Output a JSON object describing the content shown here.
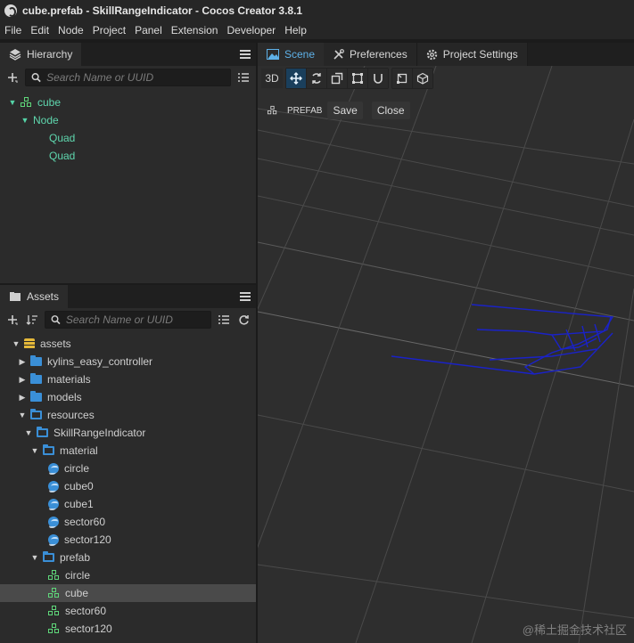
{
  "window": {
    "title": "cube.prefab - SkillRangeIndicator - Cocos Creator 3.8.1"
  },
  "menu": [
    "File",
    "Edit",
    "Node",
    "Project",
    "Panel",
    "Extension",
    "Developer",
    "Help"
  ],
  "hierarchy": {
    "tab_label": "Hierarchy",
    "search_placeholder": "Search Name or UUID",
    "nodes": [
      {
        "label": "cube",
        "depth": 0
      },
      {
        "label": "Node",
        "depth": 1
      },
      {
        "label": "Quad",
        "depth": 2
      },
      {
        "label": "Quad",
        "depth": 2
      }
    ]
  },
  "assets": {
    "tab_label": "Assets",
    "search_placeholder": "Search Name or UUID",
    "items": [
      {
        "label": "assets",
        "depth": 0,
        "icon": "assets-db-icon",
        "caret": "down"
      },
      {
        "label": "kylins_easy_controller",
        "depth": 1,
        "icon": "folder-icon",
        "caret": "right"
      },
      {
        "label": "materials",
        "depth": 1,
        "icon": "folder-icon",
        "caret": "right"
      },
      {
        "label": "models",
        "depth": 1,
        "icon": "folder-icon",
        "caret": "right"
      },
      {
        "label": "resources",
        "depth": 1,
        "icon": "folder-open-icon",
        "caret": "down"
      },
      {
        "label": "SkillRangeIndicator",
        "depth": 2,
        "icon": "folder-open-icon",
        "caret": "down"
      },
      {
        "label": "material",
        "depth": 3,
        "icon": "folder-open-icon",
        "caret": "down"
      },
      {
        "label": "circle",
        "depth": 4,
        "icon": "material-icon"
      },
      {
        "label": "cube0",
        "depth": 4,
        "icon": "material-icon"
      },
      {
        "label": "cube1",
        "depth": 4,
        "icon": "material-icon"
      },
      {
        "label": "sector60",
        "depth": 4,
        "icon": "material-icon"
      },
      {
        "label": "sector120",
        "depth": 4,
        "icon": "material-icon"
      },
      {
        "label": "prefab",
        "depth": 3,
        "icon": "folder-open-icon",
        "caret": "down"
      },
      {
        "label": "circle",
        "depth": 4,
        "icon": "prefab-icon"
      },
      {
        "label": "cube",
        "depth": 4,
        "icon": "prefab-icon",
        "selected": true
      },
      {
        "label": "sector60",
        "depth": 4,
        "icon": "prefab-icon"
      },
      {
        "label": "sector120",
        "depth": 4,
        "icon": "prefab-icon"
      }
    ]
  },
  "scene": {
    "tabs": {
      "scene": "Scene",
      "preferences": "Preferences",
      "project_settings": "Project Settings"
    },
    "toolbar": {
      "mode_3d": "3D"
    },
    "prefab_bar": {
      "label": "PREFAB",
      "save": "Save",
      "close": "Close"
    },
    "grid_color": "#4a4a4a",
    "object_color": "#1a22c8"
  },
  "watermark": "@稀土掘金技术社区"
}
